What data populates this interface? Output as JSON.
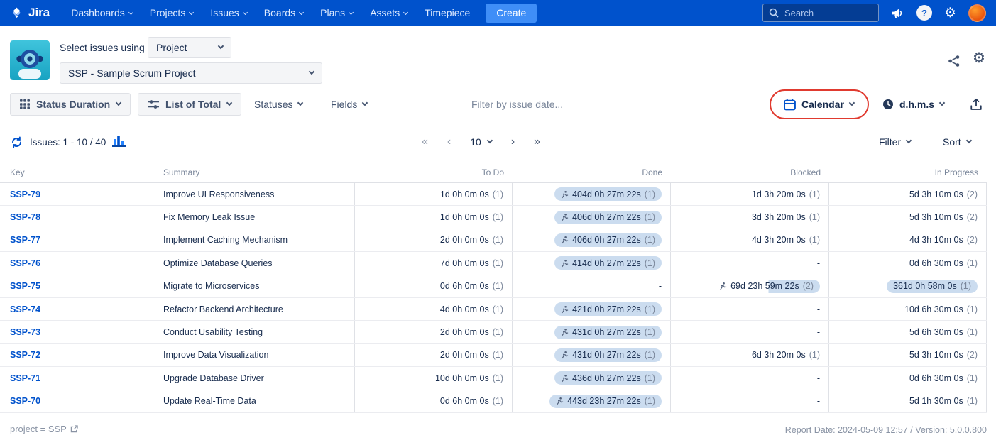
{
  "colors": {
    "navbar_bg": "#0052CC",
    "link": "#0052CC",
    "badge_bg": "#CBDCEF",
    "annotation_red": "#E03A2F",
    "create_btn": "#3F8EF7"
  },
  "icons": {
    "gear_glyph": "⚙",
    "help_glyph": "?"
  },
  "navbar": {
    "brand": "Jira",
    "menu": [
      {
        "label": "Dashboards",
        "chevron": true
      },
      {
        "label": "Projects",
        "chevron": true
      },
      {
        "label": "Issues",
        "chevron": true
      },
      {
        "label": "Boards",
        "chevron": true
      },
      {
        "label": "Plans",
        "chevron": true
      },
      {
        "label": "Assets",
        "chevron": true
      },
      {
        "label": "Timepiece",
        "chevron": false
      }
    ],
    "create_label": "Create",
    "search_placeholder": "Search"
  },
  "header": {
    "select_label": "Select issues using",
    "mode_value": "Project",
    "project_value": "SSP - Sample Scrum Project"
  },
  "toolbar": {
    "status_duration_label": "Status Duration",
    "list_of_total_label": "List of Total",
    "statuses_label": "Statuses",
    "fields_label": "Fields",
    "date_filter_placeholder": "Filter by issue date...",
    "calendar_label": "Calendar",
    "format_label": "d.h.m.s"
  },
  "issues_bar": {
    "count_text": "Issues: 1 - 10 / 40",
    "pagination": {
      "first": "«",
      "prev": "‹",
      "page_size": "10",
      "next": "›",
      "last": "»"
    },
    "filter_label": "Filter",
    "sort_label": "Sort"
  },
  "table": {
    "columns": [
      "Key",
      "Summary",
      "To Do",
      "Done",
      "Blocked",
      "In Progress"
    ],
    "rows": [
      {
        "key": "SSP-79",
        "summary": "Improve UI Responsiveness",
        "todo": {
          "t": "1d 0h 0m 0s",
          "c": "(1)"
        },
        "done": {
          "t": "404d 0h 27m 22s",
          "c": "(1)",
          "pill": true,
          "runner": true
        },
        "blocked": {
          "t": "1d 3h 20m 0s",
          "c": "(1)"
        },
        "inprogress": {
          "t": "5d 3h 10m 0s",
          "c": "(2)"
        }
      },
      {
        "key": "SSP-78",
        "summary": "Fix Memory Leak Issue",
        "todo": {
          "t": "1d 0h 0m 0s",
          "c": "(1)"
        },
        "done": {
          "t": "406d 0h 27m 22s",
          "c": "(1)",
          "pill": true,
          "runner": true
        },
        "blocked": {
          "t": "3d 3h 20m 0s",
          "c": "(1)"
        },
        "inprogress": {
          "t": "5d 3h 10m 0s",
          "c": "(2)"
        }
      },
      {
        "key": "SSP-77",
        "summary": "Implement Caching Mechanism",
        "todo": {
          "t": "2d 0h 0m 0s",
          "c": "(1)"
        },
        "done": {
          "t": "406d 0h 27m 22s",
          "c": "(1)",
          "pill": true,
          "runner": true
        },
        "blocked": {
          "t": "4d 3h 20m 0s",
          "c": "(1)"
        },
        "inprogress": {
          "t": "4d 3h 10m 0s",
          "c": "(2)"
        }
      },
      {
        "key": "SSP-76",
        "summary": "Optimize Database Queries",
        "todo": {
          "t": "7d 0h 0m 0s",
          "c": "(1)"
        },
        "done": {
          "t": "414d 0h 27m 22s",
          "c": "(1)",
          "pill": true,
          "runner": true
        },
        "blocked": {
          "t": "-"
        },
        "inprogress": {
          "t": "0d 6h 30m 0s",
          "c": "(1)"
        }
      },
      {
        "key": "SSP-75",
        "summary": "Migrate to Microservices",
        "todo": {
          "t": "0d 6h 0m 0s",
          "c": "(1)"
        },
        "done": {
          "t": "-"
        },
        "blocked": {
          "t": "69d 23h 59m 22s",
          "c": "(2)",
          "pill": true,
          "runner": true,
          "partial": true
        },
        "inprogress": {
          "t": "361d 0h 58m 0s",
          "c": "(1)",
          "pill": true
        }
      },
      {
        "key": "SSP-74",
        "summary": "Refactor Backend Architecture",
        "todo": {
          "t": "4d 0h 0m 0s",
          "c": "(1)"
        },
        "done": {
          "t": "421d 0h 27m 22s",
          "c": "(1)",
          "pill": true,
          "runner": true
        },
        "blocked": {
          "t": "-"
        },
        "inprogress": {
          "t": "10d 6h 30m 0s",
          "c": "(1)"
        }
      },
      {
        "key": "SSP-73",
        "summary": "Conduct Usability Testing",
        "todo": {
          "t": "2d 0h 0m 0s",
          "c": "(1)"
        },
        "done": {
          "t": "431d 0h 27m 22s",
          "c": "(1)",
          "pill": true,
          "runner": true
        },
        "blocked": {
          "t": "-"
        },
        "inprogress": {
          "t": "5d 6h 30m 0s",
          "c": "(1)"
        }
      },
      {
        "key": "SSP-72",
        "summary": "Improve Data Visualization",
        "todo": {
          "t": "2d 0h 0m 0s",
          "c": "(1)"
        },
        "done": {
          "t": "431d 0h 27m 22s",
          "c": "(1)",
          "pill": true,
          "runner": true
        },
        "blocked": {
          "t": "6d 3h 20m 0s",
          "c": "(1)"
        },
        "inprogress": {
          "t": "5d 3h 10m 0s",
          "c": "(2)"
        }
      },
      {
        "key": "SSP-71",
        "summary": "Upgrade Database Driver",
        "todo": {
          "t": "10d 0h 0m 0s",
          "c": "(1)"
        },
        "done": {
          "t": "436d 0h 27m 22s",
          "c": "(1)",
          "pill": true,
          "runner": true
        },
        "blocked": {
          "t": "-"
        },
        "inprogress": {
          "t": "0d 6h 30m 0s",
          "c": "(1)"
        }
      },
      {
        "key": "SSP-70",
        "summary": "Update Real-Time Data",
        "todo": {
          "t": "0d 6h 0m 0s",
          "c": "(1)"
        },
        "done": {
          "t": "443d 23h 27m 22s",
          "c": "(1)",
          "pill": true,
          "runner": true
        },
        "blocked": {
          "t": "-"
        },
        "inprogress": {
          "t": "5d 1h 30m 0s",
          "c": "(1)"
        }
      }
    ]
  },
  "footer": {
    "filter_text": "project = SSP",
    "report_info": "Report Date: 2024-05-09 12:57 / Version: 5.0.0.800"
  }
}
